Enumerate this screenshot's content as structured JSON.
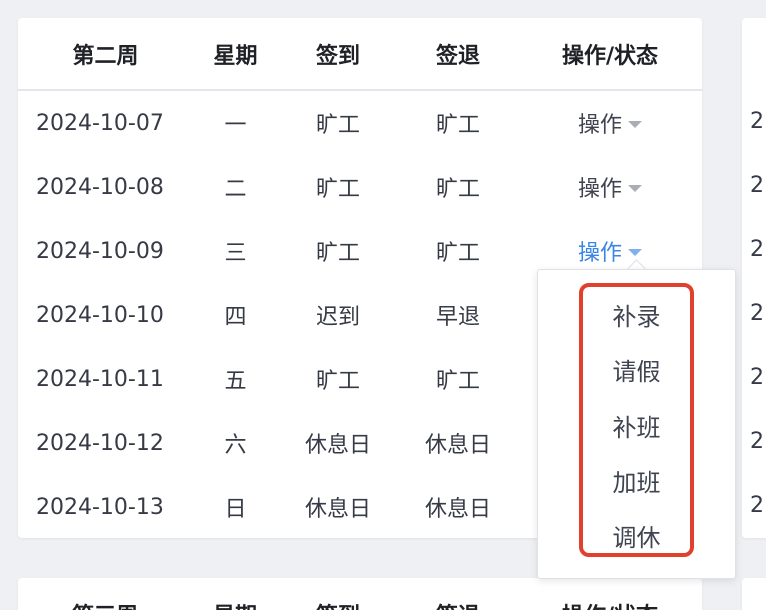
{
  "table": {
    "headers": [
      "第二周",
      "星期",
      "签到",
      "签退",
      "操作/状态"
    ],
    "rows": [
      {
        "date": "2024-10-07",
        "weekday": "一",
        "sign_in": "旷工",
        "sign_out": "旷工",
        "action": "操作"
      },
      {
        "date": "2024-10-08",
        "weekday": "二",
        "sign_in": "旷工",
        "sign_out": "旷工",
        "action": "操作"
      },
      {
        "date": "2024-10-09",
        "weekday": "三",
        "sign_in": "旷工",
        "sign_out": "旷工",
        "action": "操作"
      },
      {
        "date": "2024-10-10",
        "weekday": "四",
        "sign_in": "迟到",
        "sign_out": "早退"
      },
      {
        "date": "2024-10-11",
        "weekday": "五",
        "sign_in": "旷工",
        "sign_out": "旷工"
      },
      {
        "date": "2024-10-12",
        "weekday": "六",
        "sign_in": "休息日",
        "sign_out": "休息日"
      },
      {
        "date": "2024-10-13",
        "weekday": "日",
        "sign_in": "休息日",
        "sign_out": "休息日"
      }
    ]
  },
  "dropdown_menu": {
    "items": [
      "补录",
      "请假",
      "补班",
      "加班",
      "调休"
    ]
  },
  "next_table_header": {
    "headers": [
      "第三周",
      "星期",
      "签到",
      "签退",
      "操作/状态"
    ]
  },
  "right_column_fragments": [
    "2",
    "2",
    "2",
    "2",
    "2",
    "2",
    "2"
  ],
  "colors": {
    "absent": "#e8a33b",
    "late_early": "#e34d2d",
    "rest_day": "#3a86e6",
    "active_action": "#3a86e6",
    "highlight_border": "#e0412c"
  }
}
